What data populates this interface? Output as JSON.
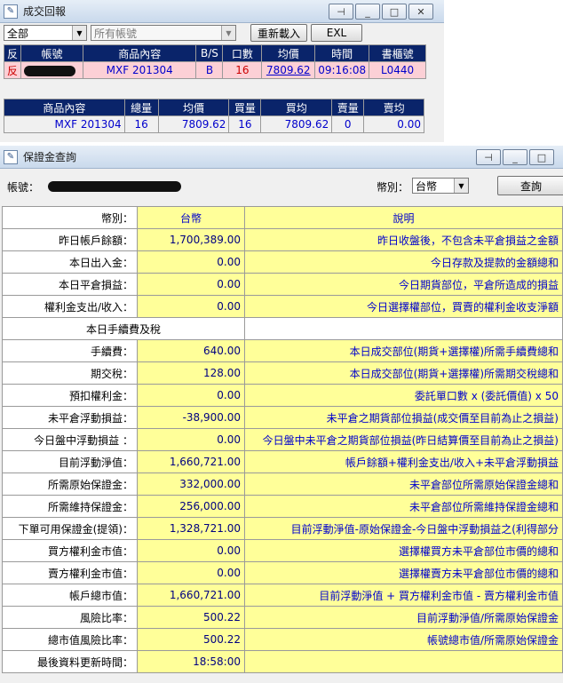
{
  "trade_window": {
    "title": "成交回報",
    "filter_select": "全部",
    "account_select_placeholder": "所有帳號",
    "reload_button": "重新載入",
    "exl_button": "EXL",
    "columns": [
      "反",
      "帳號",
      "商品內容",
      "B/S",
      "口數",
      "均價",
      "時間",
      "書櫃號"
    ],
    "rows": [
      {
        "flag": "反",
        "product": "MXF 201304",
        "bs": "B",
        "qty": "16",
        "avg": "7809.62",
        "time": "09:16:08",
        "order_no": "L0440"
      }
    ],
    "summary_columns": [
      "商品內容",
      "總量",
      "均價",
      "買量",
      "買均",
      "賣量",
      "賣均"
    ],
    "summary_rows": [
      {
        "product": "MXF 201304",
        "total": "16",
        "avg": "7809.62",
        "buy_qty": "16",
        "buy_avg": "7809.62",
        "sell_qty": "0",
        "sell_avg": "0.00"
      }
    ]
  },
  "margin_window": {
    "title": "保證金查詢",
    "account_label": "帳號：",
    "currency_label": "幣別：",
    "currency_select": "台幣",
    "query_button": "查詢",
    "header": {
      "label": "幣別：",
      "value": "台幣",
      "desc": "說明"
    },
    "section_label": "本日手續費及稅",
    "rows_top": [
      {
        "label": "昨日帳戶餘額：",
        "value": "1,700,389.00",
        "desc": "昨日收盤後，不包含未平倉損益之金額"
      },
      {
        "label": "本日出入金：",
        "value": "0.00",
        "desc": "今日存款及提款的金額總和"
      },
      {
        "label": "本日平倉損益：",
        "value": "0.00",
        "desc": "今日期貨部位，平倉所造成的損益"
      },
      {
        "label": "權利金支出/收入：",
        "value": "0.00",
        "desc": "今日選擇權部位，買賣的權利金收支淨額"
      }
    ],
    "rows_bottom": [
      {
        "label": "手續費：",
        "value": "640.00",
        "desc": "本日成交部位(期貨+選擇權)所需手續費總和"
      },
      {
        "label": "期交稅：",
        "value": "128.00",
        "desc": "本日成交部位(期貨+選擇權)所需期交稅總和"
      },
      {
        "label": "預扣權利金：",
        "value": "0.00",
        "desc": "委託單口數 x (委託價值) x 50"
      },
      {
        "label": "未平倉浮動損益：",
        "value": "-38,900.00",
        "desc": "未平倉之期貨部位損益(成交價至目前為止之損益)"
      },
      {
        "label": "今日盤中浮動損益 ：",
        "value": "0.00",
        "desc": "今日盤中未平倉之期貨部位損益(昨日結算價至目前為止之損益)"
      },
      {
        "label": "目前浮動淨值：",
        "value": "1,660,721.00",
        "desc": "帳戶餘額+權利金支出/收入+未平倉浮動損益"
      },
      {
        "label": "所需原始保證金：",
        "value": "332,000.00",
        "desc": "未平倉部位所需原始保證金總和"
      },
      {
        "label": "所需維持保證金：",
        "value": "256,000.00",
        "desc": "未平倉部位所需維持保證金總和"
      },
      {
        "label": "下單可用保證金(提領)：",
        "value": "1,328,721.00",
        "desc": "目前浮動淨值-原始保證金-今日盤中浮動損益之(利得部分"
      },
      {
        "label": "買方權利金市值：",
        "value": "0.00",
        "desc": "選擇權買方未平倉部位市價的總和"
      },
      {
        "label": "賣方權利金市值：",
        "value": "0.00",
        "desc": "選擇權賣方未平倉部位市價的總和"
      },
      {
        "label": "帳戶總市值：",
        "value": "1,660,721.00",
        "desc": "目前浮動淨值 + 買方權利金市值 - 賣方權利金市值"
      },
      {
        "label": "風險比率：",
        "value": "500.22",
        "desc": "目前浮動淨值/所需原始保證金"
      },
      {
        "label": "總市值風險比率：",
        "value": "500.22",
        "desc": "帳號總市值/所需原始保證金"
      },
      {
        "label": "最後資料更新時間：",
        "value": "18:58:00",
        "desc": ""
      }
    ]
  }
}
